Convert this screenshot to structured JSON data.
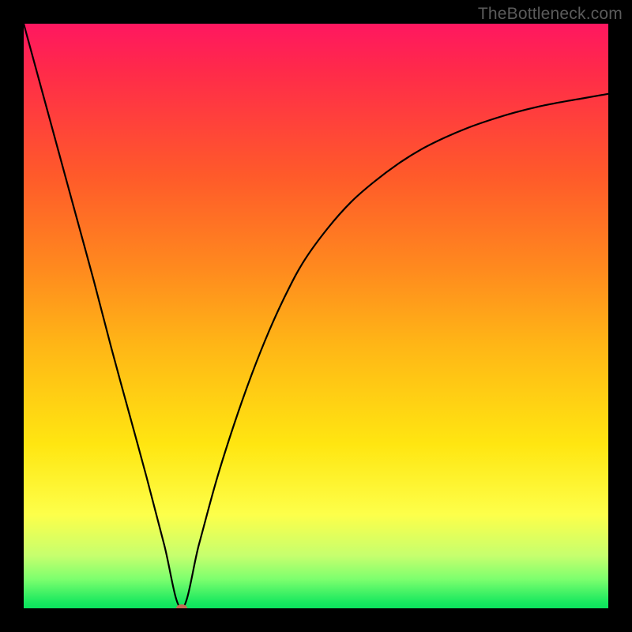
{
  "watermark": "TheBottleneck.com",
  "colors": {
    "curve_stroke": "#000000",
    "marker_fill": "#c76a55",
    "frame": "#000000"
  },
  "chart_data": {
    "type": "line",
    "title": "",
    "xlabel": "",
    "ylabel": "",
    "xlim": [
      0,
      100
    ],
    "ylim": [
      0,
      100
    ],
    "grid": false,
    "legend": false,
    "annotations": [
      {
        "kind": "marker",
        "x": 27,
        "y": 0,
        "color": "#c76a55",
        "shape": "ellipse"
      }
    ],
    "series": [
      {
        "name": "bottleneck_curve",
        "x": [
          0,
          3,
          6,
          9,
          12,
          15,
          18,
          21,
          24,
          27,
          30,
          33,
          36,
          39,
          42,
          45,
          48,
          52,
          56,
          60,
          64,
          68,
          72,
          76,
          80,
          84,
          88,
          92,
          96,
          100
        ],
        "y": [
          100,
          89,
          78,
          67,
          56,
          44.5,
          33.5,
          22.5,
          11,
          0,
          11,
          22,
          31.5,
          40,
          47.5,
          54,
          59.5,
          65,
          69.5,
          73,
          76,
          78.5,
          80.5,
          82.2,
          83.6,
          84.8,
          85.8,
          86.6,
          87.3,
          88
        ]
      }
    ]
  }
}
